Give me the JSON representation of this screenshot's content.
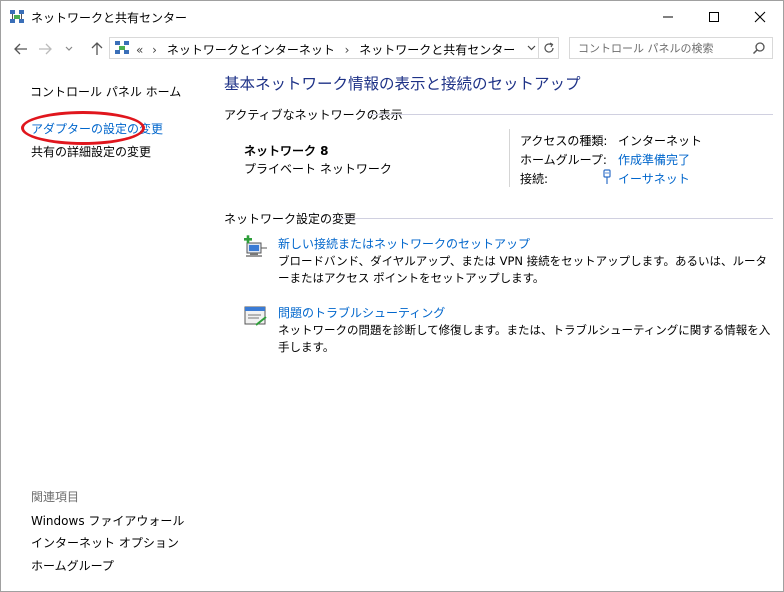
{
  "window": {
    "title": "ネットワークと共有センター"
  },
  "address_bar": {
    "overflow": "«",
    "crumbs": [
      "ネットワークとインターネット",
      "ネットワークと共有センター"
    ],
    "separator": "›"
  },
  "search": {
    "placeholder": "コントロール パネルの検索"
  },
  "sidebar": {
    "home": "コントロール パネル ホーム",
    "items": [
      {
        "label": "アダプターの設定の変更"
      },
      {
        "label": "共有の詳細設定の変更"
      }
    ],
    "related_heading": "関連項目",
    "related_items": [
      {
        "label": "Windows ファイアウォール"
      },
      {
        "label": "インターネット オプション"
      },
      {
        "label": "ホームグループ"
      }
    ]
  },
  "main": {
    "title": "基本ネットワーク情報の表示と接続のセットアップ",
    "active_heading": "アクティブなネットワークの表示",
    "network": {
      "name": "ネットワーク 8",
      "type": "プライベート ネットワーク",
      "access_type_label": "アクセスの種類:",
      "access_type_value": "インターネット",
      "homegroup_label": "ホームグループ:",
      "homegroup_value": "作成準備完了",
      "connection_label": "接続:",
      "connection_value": "イーサネット"
    },
    "settings_heading": "ネットワーク設定の変更",
    "tasks": [
      {
        "title": "新しい接続またはネットワークのセットアップ",
        "desc": "ブロードバンド、ダイヤルアップ、または VPN 接続をセットアップします。あるいは、ルーターまたはアクセス ポイントをセットアップします。"
      },
      {
        "title": "問題のトラブルシューティング",
        "desc": "ネットワークの問題を診断して修復します。または、トラブルシューティングに関する情報を入手します。"
      }
    ]
  },
  "colors": {
    "link": "#0066cc",
    "title": "#1e3287",
    "highlight": "#e0161d"
  }
}
